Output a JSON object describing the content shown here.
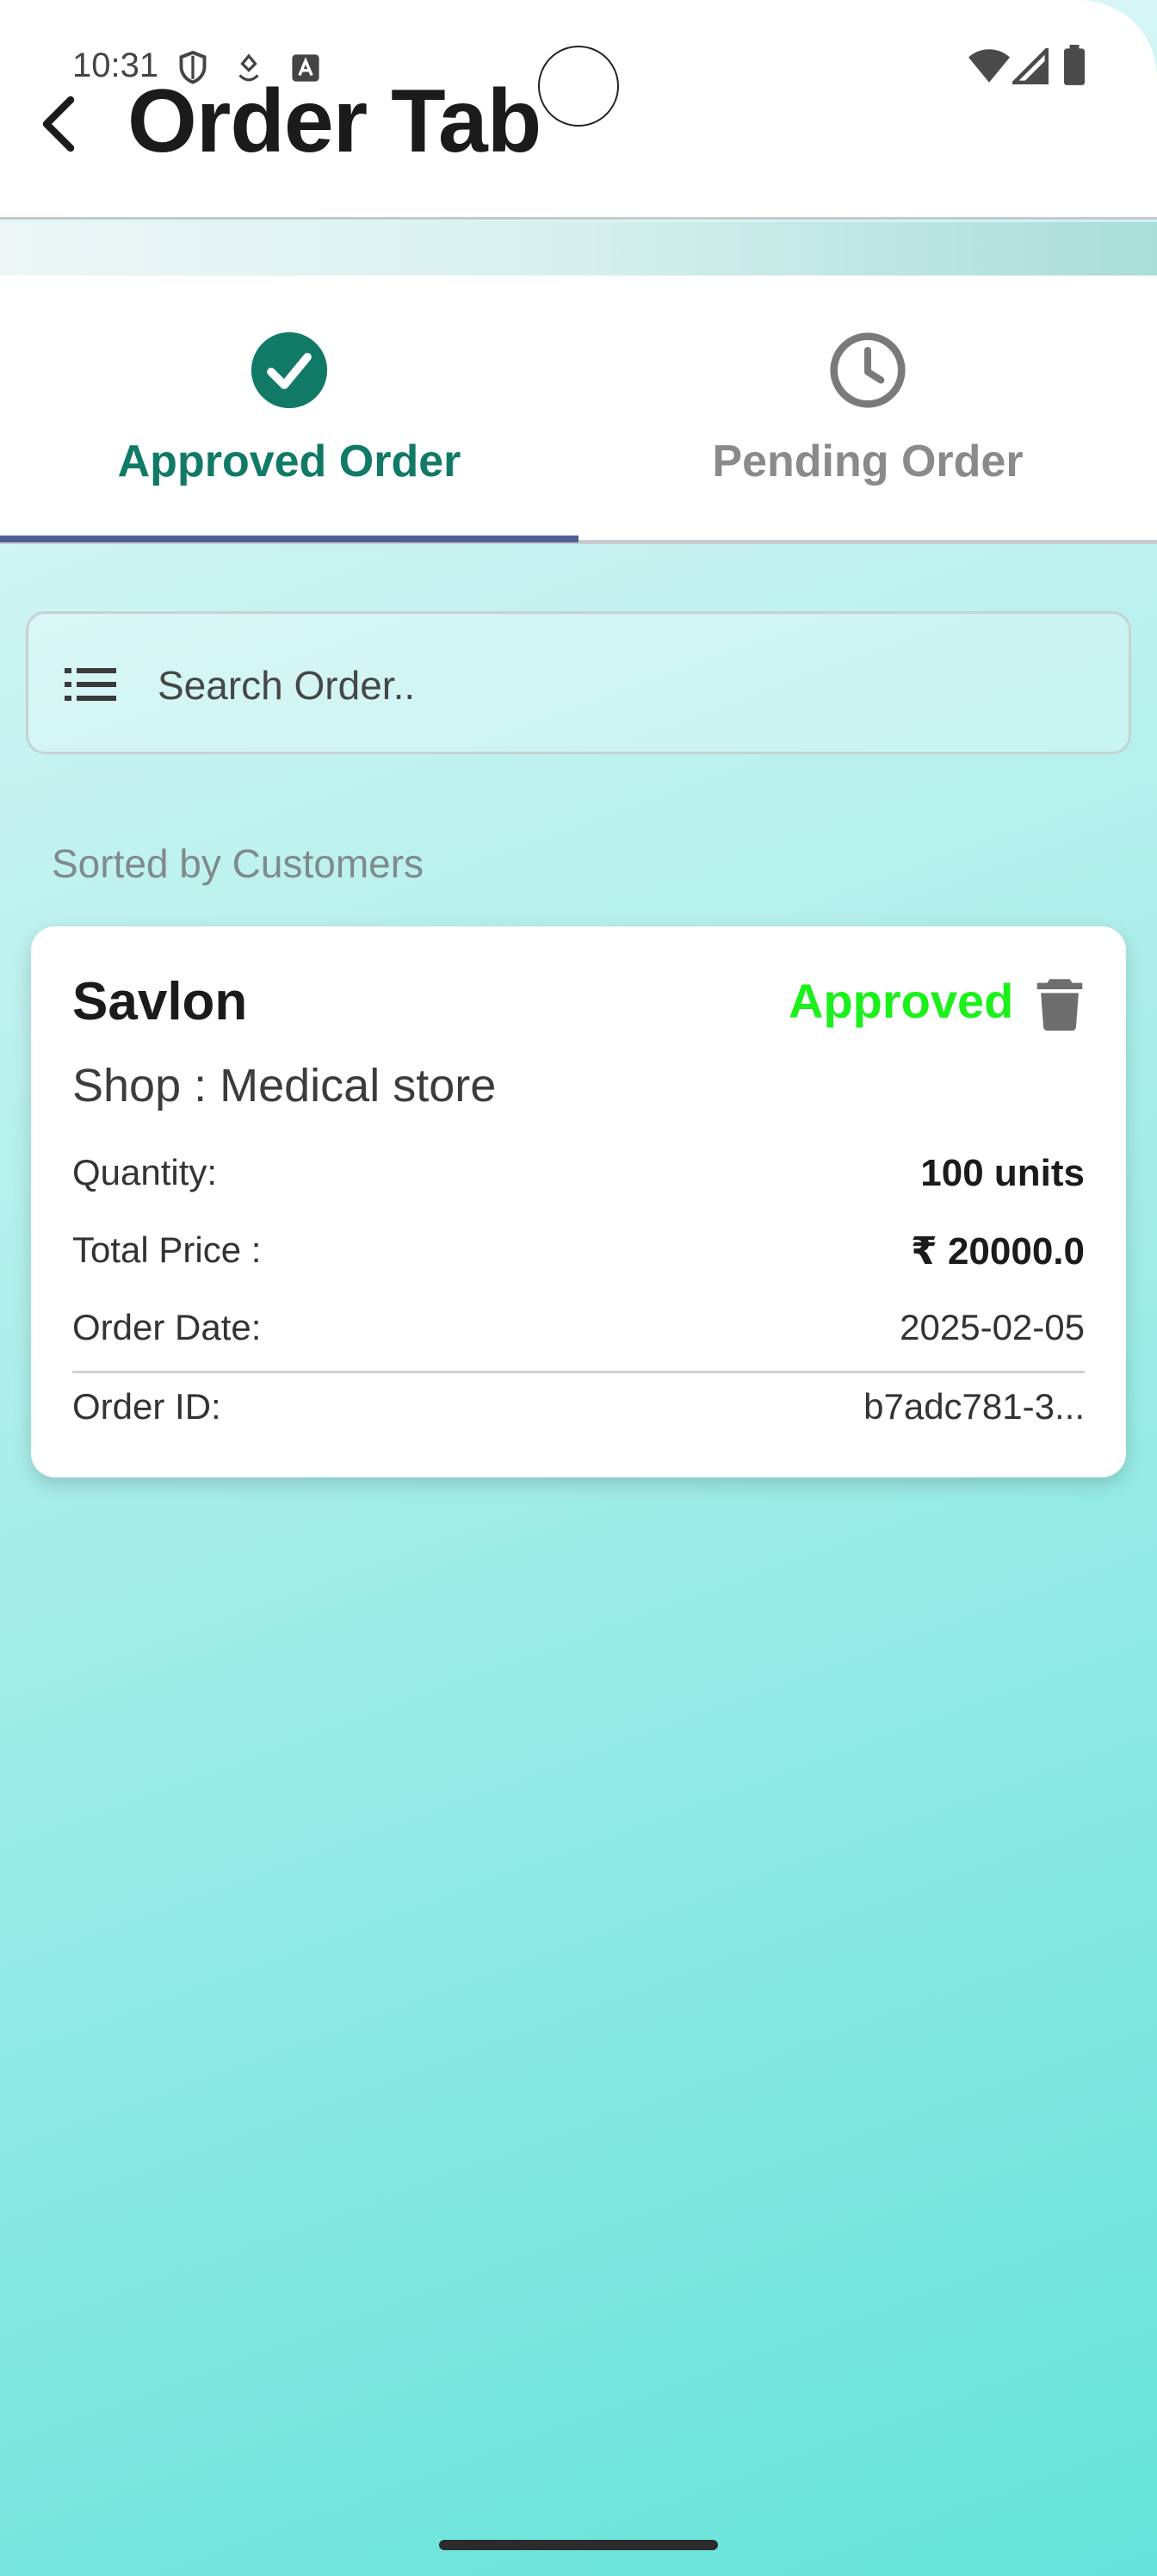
{
  "status_bar": {
    "time": "10:31"
  },
  "header": {
    "title": "Order Tab"
  },
  "tabs": [
    {
      "label": "Approved Order",
      "icon": "check-circle-icon",
      "active": true,
      "color": "#117a66"
    },
    {
      "label": "Pending Order",
      "icon": "clock-icon",
      "active": false,
      "color": "#8a8a8a"
    }
  ],
  "search": {
    "placeholder": "Search Order..",
    "value": ""
  },
  "sort_label": "Sorted by Customers",
  "orders": [
    {
      "name": "Savlon",
      "status": "Approved",
      "status_color": "#1bf01b",
      "shop": "Shop : Medical store",
      "quantity_label": "Quantity:",
      "quantity": "100 units",
      "price_label": "Total Price :",
      "price": "₹ 20000.0",
      "date_label": "Order Date:",
      "date": "2025-02-05",
      "id_label": "Order ID:",
      "id": "b7adc781-3..."
    }
  ],
  "colors": {
    "accent": "#117a66",
    "tab_indicator": "#4e5f96",
    "approved_green": "#1bf01b"
  }
}
